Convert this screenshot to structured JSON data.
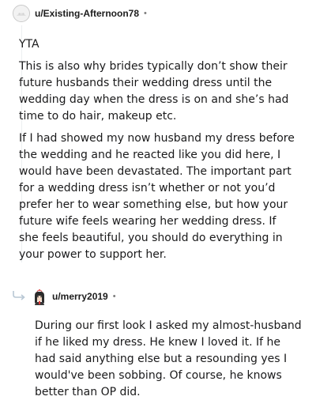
{
  "comment": {
    "username": "u/Existing-Afternoon78",
    "separator": "•",
    "paragraphs": [
      "YTA",
      "This is also why brides typically don’t show their future husbands their wedding dress until the wedding day when the dress is on and she’s had time to do hair, makeup etc.",
      "If I had showed my now husband my dress before the wedding and he reacted like you did here, I would have been devastated. The important part for a wedding dress isn’t whether or not you’d prefer her to wear something else, but how your future wife feels wearing her wedding dress. If she feels beautiful, you should do everything in your power to support her."
    ]
  },
  "reply": {
    "username": "u/merry2019",
    "separator": "•",
    "paragraphs": [
      "During our first look I asked my almost-husband if he liked my dress. He knew I loved it. If he had said anything else but a resounding yes I would've been sobbing. Of course, he knows better than OP did."
    ]
  },
  "icons": {
    "comment_avatar": "default-avatar-icon",
    "reply_arrow": "reply-arrow-icon",
    "reply_avatar": "user-avatar-icon"
  }
}
